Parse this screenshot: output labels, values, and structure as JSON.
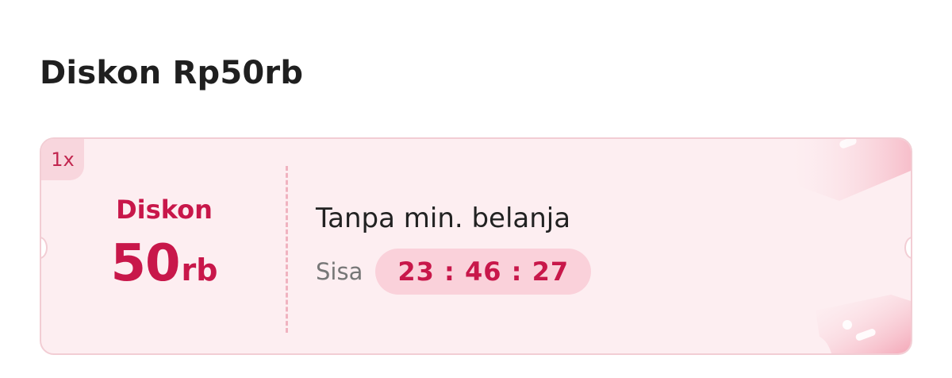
{
  "page": {
    "title": "Diskon Rp50rb"
  },
  "voucher": {
    "quantity_badge": "1x",
    "amount_label": "Diskon",
    "amount_number": "50",
    "amount_unit": "rb",
    "condition": "Tanpa min. belanja",
    "remaining_label": "Sisa",
    "countdown": "23 : 46 : 27"
  },
  "colors": {
    "accent": "#c8174a",
    "card_background": "#fdeef1",
    "card_border": "#f2cdd4",
    "countdown_background": "#fad1da"
  },
  "icons": [
    "ticket-decoration-icon"
  ]
}
